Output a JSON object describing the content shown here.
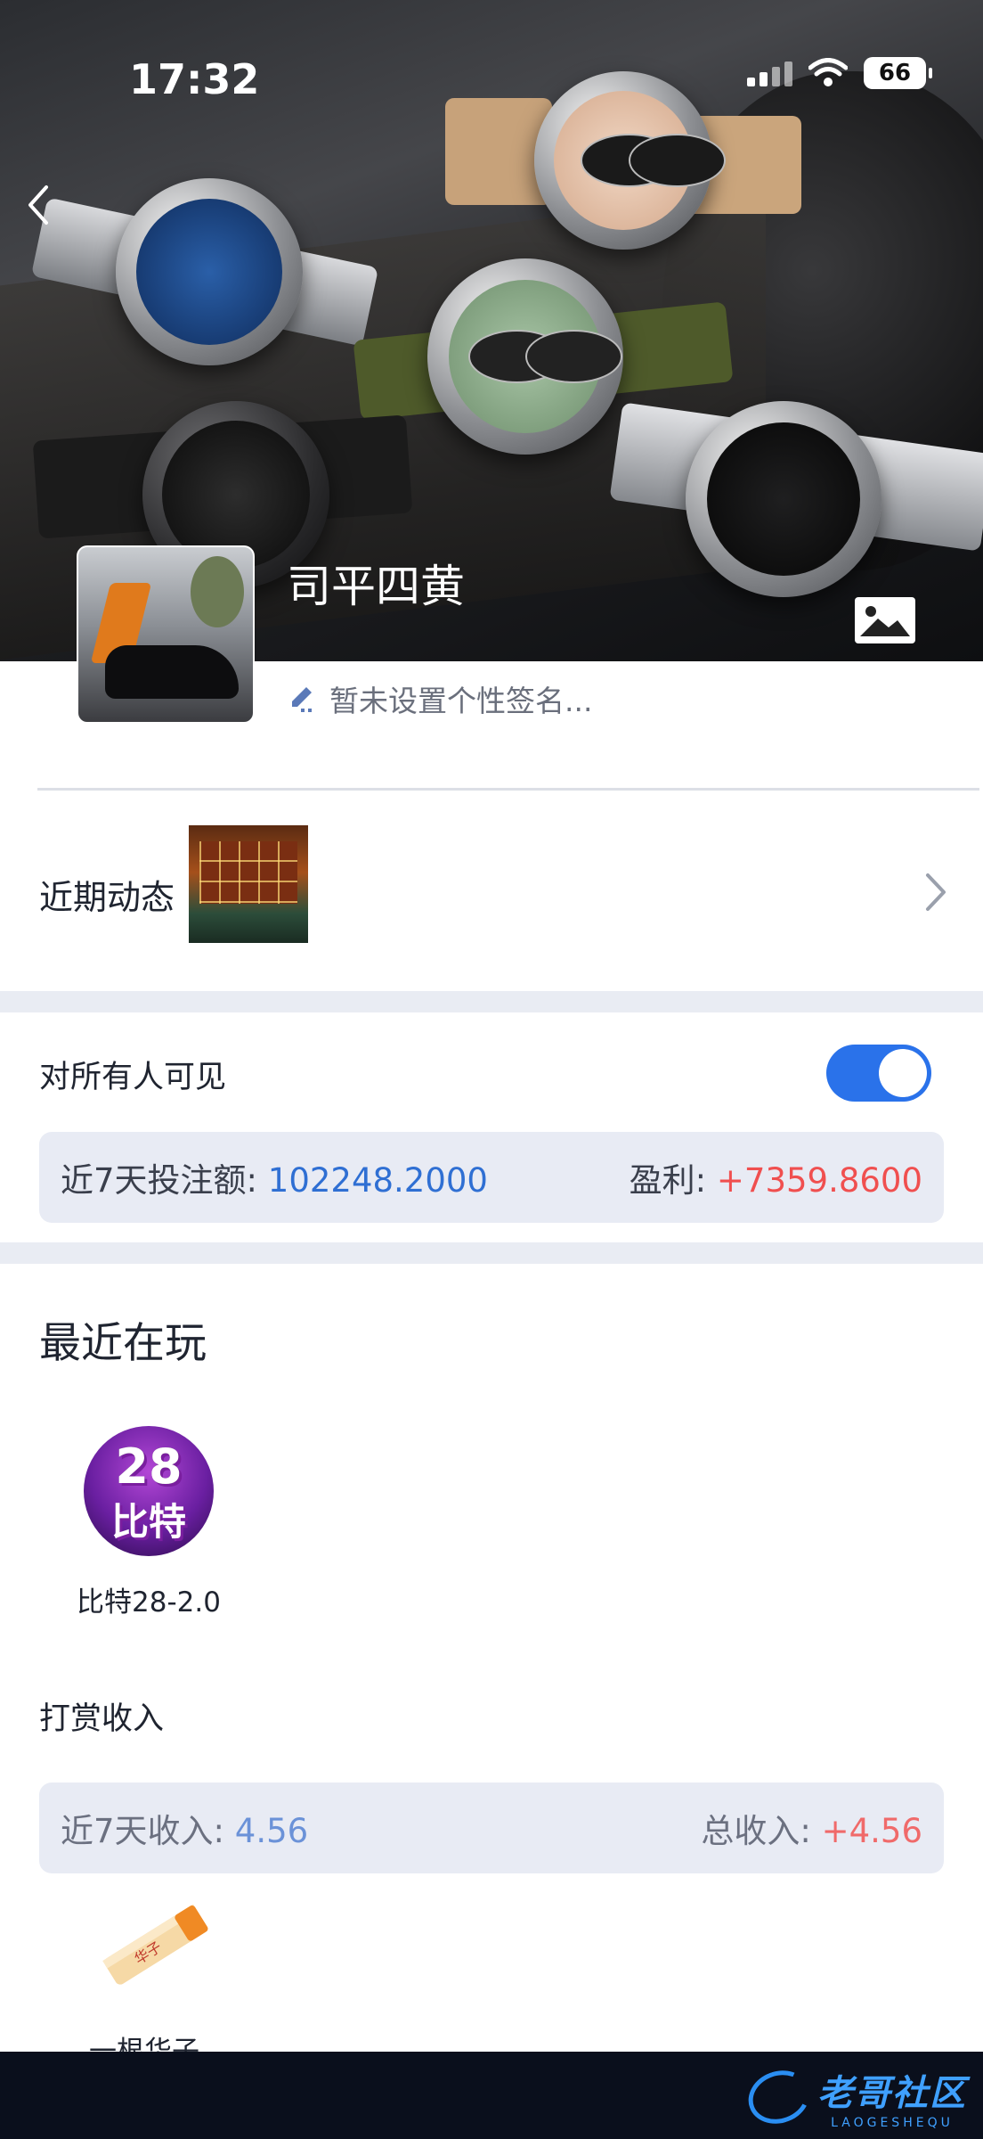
{
  "status_bar": {
    "time": "17:32",
    "battery": "66"
  },
  "profile": {
    "username": "司平四黄",
    "signature": "暂未设置个性签名..."
  },
  "recent_activity": {
    "label": "近期动态"
  },
  "visibility": {
    "label": "对所有人可见",
    "enabled": true
  },
  "bet_stats": {
    "amount_label": "近7天投注额:",
    "amount_value": "102248.2000",
    "profit_label": "盈利:",
    "profit_value": "+7359.8600"
  },
  "recently_playing": {
    "title": "最近在玩",
    "games": [
      {
        "name": "比特28-2.0",
        "icon_line1": "28",
        "icon_line2": "比特"
      }
    ]
  },
  "rewards": {
    "title": "打赏收入",
    "week_label": "近7天收入:",
    "week_value": "4.56",
    "total_label": "总收入:",
    "total_value": "+4.56",
    "gift_label": "一根华子",
    "gift_text": "华子"
  },
  "brand": {
    "name": "老哥社区",
    "subtitle": "LAOGESHEQU"
  },
  "colors": {
    "accent_blue": "#2f6fd3",
    "profit_red": "#f04f4f",
    "toggle_on": "#2a72ea",
    "band": "#e9ecf3"
  }
}
